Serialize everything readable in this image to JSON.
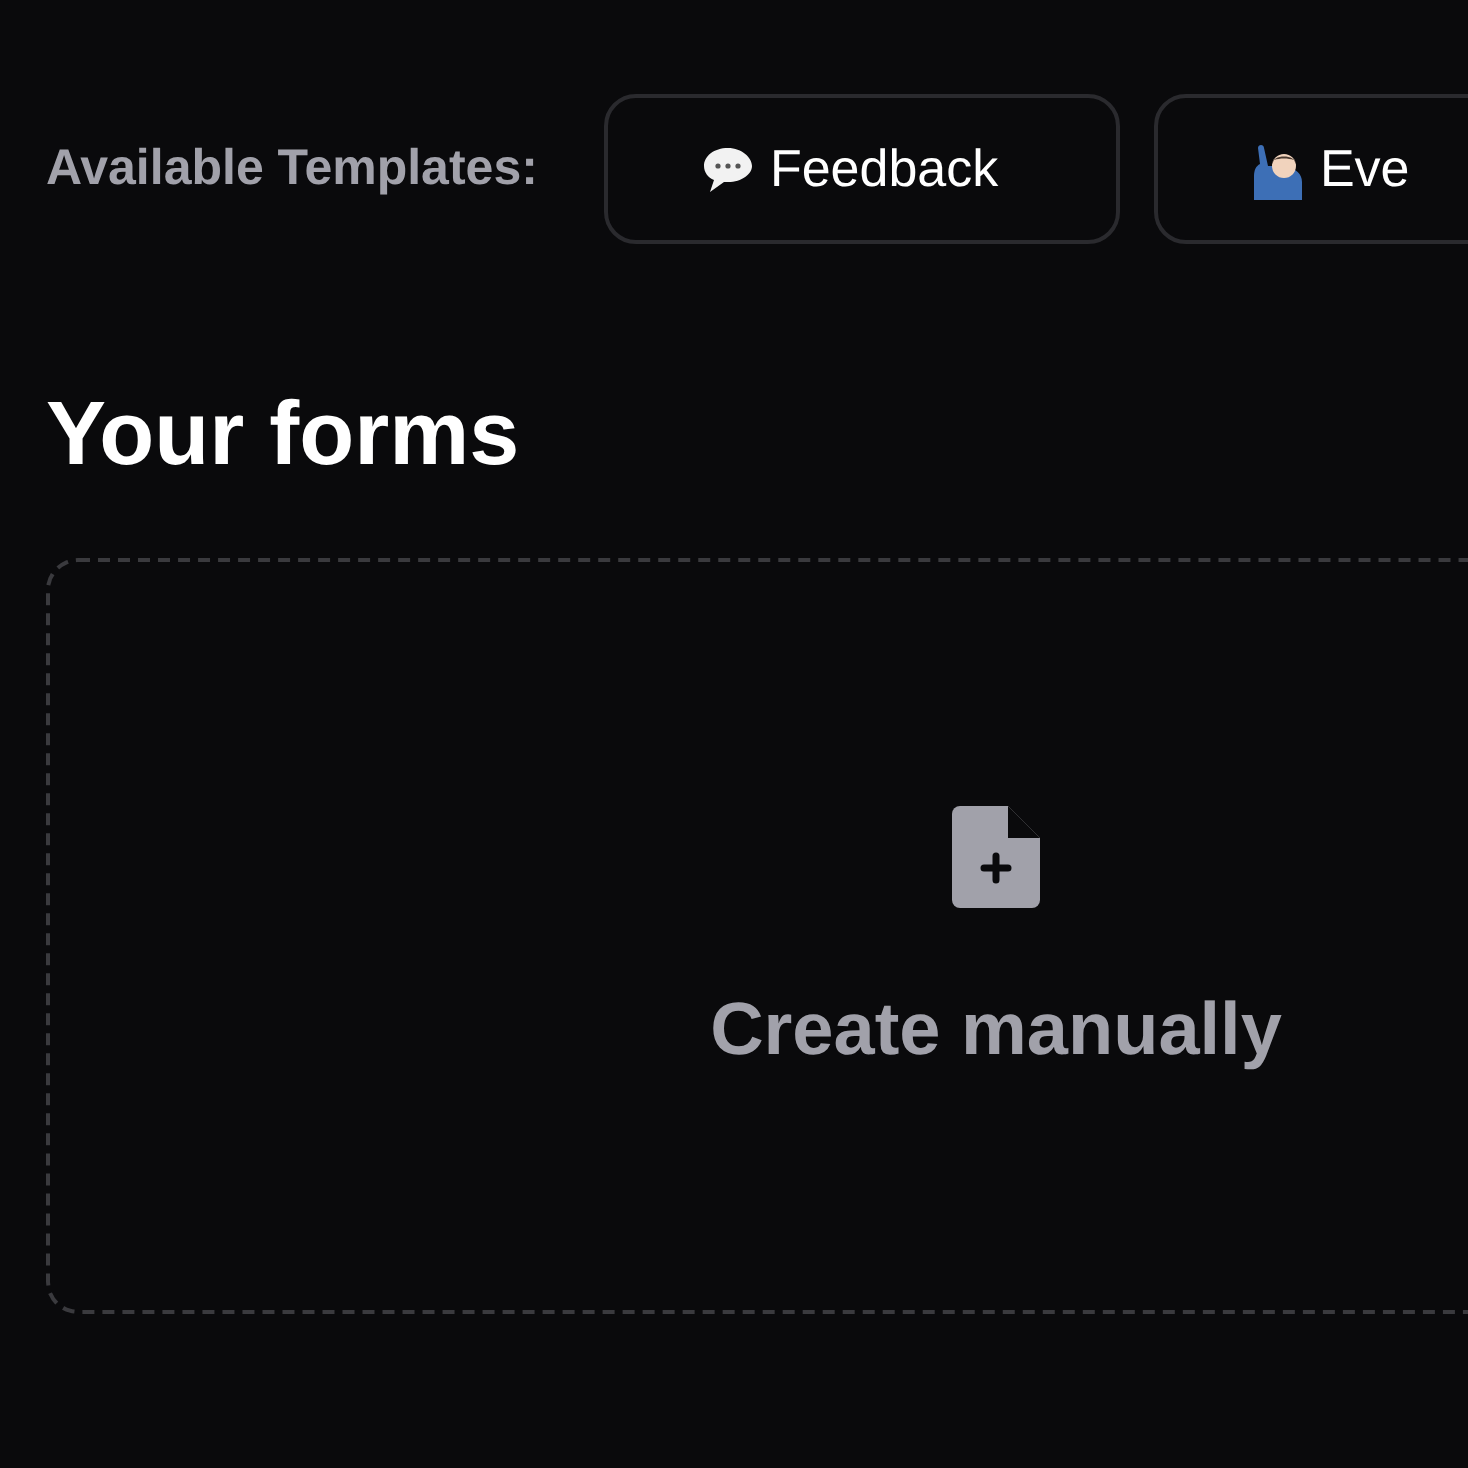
{
  "templates": {
    "label": "Available Templates:",
    "items": [
      {
        "kind": "chat",
        "label": "Feedback"
      },
      {
        "kind": "person",
        "label": "Eve"
      }
    ]
  },
  "forms": {
    "title": "Your forms",
    "create": {
      "label": "Create manually"
    }
  }
}
